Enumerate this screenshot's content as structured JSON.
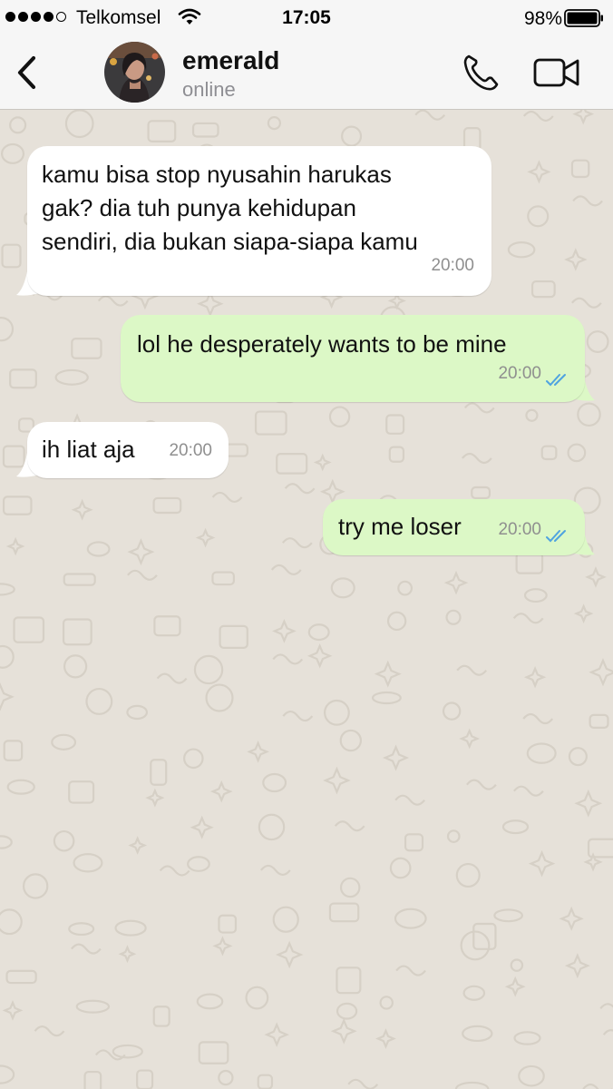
{
  "status_bar": {
    "carrier": "Telkomsel",
    "time": "17:05",
    "battery": "98%",
    "signal_bars": 4,
    "signal_total": 5
  },
  "header": {
    "contact_name": "emerald",
    "contact_status": "online",
    "icons": [
      "back-chevron-icon",
      "phone-icon",
      "video-camera-icon"
    ]
  },
  "messages": [
    {
      "direction": "incoming",
      "lines": [
        "kamu bisa stop nyusahin harukas",
        "gak? dia tuh punya kehidupan",
        "sendiri, dia bukan siapa-siapa kamu"
      ],
      "time": "20:00"
    },
    {
      "direction": "outgoing",
      "lines": [
        "lol he desperately wants to be mine"
      ],
      "time": "20:00",
      "status": "read"
    },
    {
      "direction": "incoming",
      "lines": [
        "ih liat aja"
      ],
      "time": "20:00"
    },
    {
      "direction": "outgoing",
      "lines": [
        "try me loser"
      ],
      "time": "20:00",
      "status": "read"
    }
  ],
  "colors": {
    "incoming_bubble": "#ffffff",
    "outgoing_bubble": "#dcf8c6",
    "read_ticks": "#4fa3e0",
    "wallpaper": "#e6e1d9"
  }
}
